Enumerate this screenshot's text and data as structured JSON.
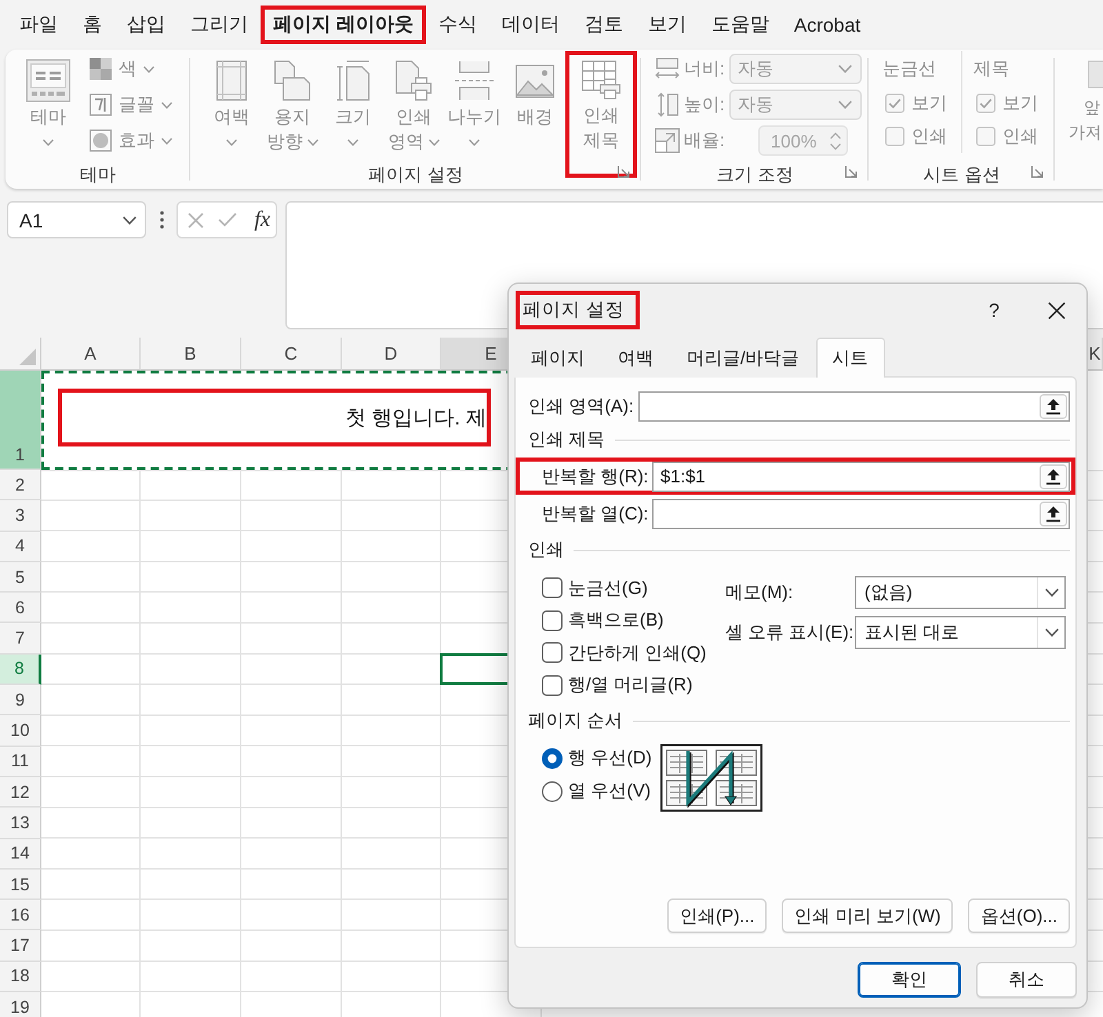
{
  "menu_tabs": [
    {
      "label": "파일",
      "selected": false,
      "highlighted": false
    },
    {
      "label": "홈",
      "selected": false,
      "highlighted": false
    },
    {
      "label": "삽입",
      "selected": false,
      "highlighted": false
    },
    {
      "label": "그리기",
      "selected": false,
      "highlighted": false
    },
    {
      "label": "페이지 레이아웃",
      "selected": true,
      "highlighted": true
    },
    {
      "label": "수식",
      "selected": false,
      "highlighted": false
    },
    {
      "label": "데이터",
      "selected": false,
      "highlighted": false
    },
    {
      "label": "검토",
      "selected": false,
      "highlighted": false
    },
    {
      "label": "보기",
      "selected": false,
      "highlighted": false
    },
    {
      "label": "도움말",
      "selected": false,
      "highlighted": false
    },
    {
      "label": "Acrobat",
      "selected": false,
      "highlighted": false
    }
  ],
  "ribbon": {
    "theme_group": {
      "title": "테마",
      "main": {
        "label": "테마",
        "dropdown": true
      },
      "items": [
        {
          "label": "색",
          "dropdown": true
        },
        {
          "label": "글꼴",
          "dropdown": true
        },
        {
          "label": "효과",
          "dropdown": true
        }
      ]
    },
    "page_setup_group": {
      "title": "페이지 설정",
      "buttons": [
        {
          "lines": [
            "여백"
          ],
          "dropdown": true,
          "highlighted": false
        },
        {
          "lines": [
            "용지",
            "방향"
          ],
          "dropdown": true,
          "highlighted": false
        },
        {
          "lines": [
            "크기"
          ],
          "dropdown": true,
          "highlighted": false
        },
        {
          "lines": [
            "인쇄",
            "영역"
          ],
          "dropdown": true,
          "highlighted": false
        },
        {
          "lines": [
            "나누기"
          ],
          "dropdown": true,
          "highlighted": false
        },
        {
          "lines": [
            "배경"
          ],
          "dropdown": false,
          "highlighted": false
        },
        {
          "lines": [
            "인쇄",
            "제목"
          ],
          "dropdown": false,
          "highlighted": true
        }
      ]
    },
    "scale_group": {
      "title": "크기 조정",
      "rows": [
        {
          "kind": "dropdown",
          "label": "너비:",
          "value": "자동"
        },
        {
          "kind": "dropdown",
          "label": "높이:",
          "value": "자동"
        },
        {
          "kind": "spinner",
          "label": "배율:",
          "value": "100%"
        }
      ]
    },
    "sheet_options_group": {
      "title": "시트 옵션",
      "columns": [
        {
          "heading": "눈금선",
          "options": [
            {
              "label": "보기",
              "checked": true
            },
            {
              "label": "인쇄",
              "checked": false
            }
          ]
        },
        {
          "heading": "제목",
          "options": [
            {
              "label": "보기",
              "checked": true
            },
            {
              "label": "인쇄",
              "checked": false
            }
          ]
        }
      ]
    },
    "group_5": {
      "lines": [
        "앞",
        "가져"
      ]
    }
  },
  "formula_bar": {
    "name_box": "A1",
    "function_label": "fx"
  },
  "sheet": {
    "columns": [
      {
        "label": "A",
        "active": false
      },
      {
        "label": "B",
        "active": false
      },
      {
        "label": "C",
        "active": false
      },
      {
        "label": "D",
        "active": false
      },
      {
        "label": "E",
        "active": true
      }
    ],
    "right_columns": [
      {
        "label": "K",
        "active": false
      }
    ],
    "title_row": {
      "label": "1",
      "selected": true,
      "marquee": true,
      "highlighted": true,
      "text": "첫 행입니다. 제"
    },
    "rows": [
      {
        "label": "2",
        "active": false
      },
      {
        "label": "3",
        "active": false
      },
      {
        "label": "4",
        "active": false
      },
      {
        "label": "5",
        "active": false
      },
      {
        "label": "6",
        "active": false
      },
      {
        "label": "7",
        "active": false
      },
      {
        "label": "8",
        "active": true
      },
      {
        "label": "9",
        "active": false
      },
      {
        "label": "10",
        "active": false
      },
      {
        "label": "11",
        "active": false
      },
      {
        "label": "12",
        "active": false
      },
      {
        "label": "13",
        "active": false
      },
      {
        "label": "14",
        "active": false
      },
      {
        "label": "15",
        "active": false
      },
      {
        "label": "16",
        "active": false
      },
      {
        "label": "17",
        "active": false
      },
      {
        "label": "18",
        "active": false
      },
      {
        "label": "19",
        "active": false
      }
    ]
  },
  "dialog": {
    "title": {
      "text": "페이지 설정",
      "highlighted": true
    },
    "help": "?",
    "tabs": [
      {
        "label": "페이지",
        "selected": false
      },
      {
        "label": "여백",
        "selected": false
      },
      {
        "label": "머리글/바닥글",
        "selected": false
      },
      {
        "label": "시트",
        "selected": true
      }
    ],
    "print_area": {
      "label": "인쇄 영역(A):"
    },
    "print_titles": {
      "heading": "인쇄 제목",
      "fields": [
        {
          "label": "반복할 행(R):",
          "value": "$1:$1",
          "highlighted": true
        },
        {
          "label": "반복할 열(C):",
          "highlighted": false
        }
      ]
    },
    "print": {
      "heading": "인쇄",
      "options": [
        {
          "label": "눈금선(G)",
          "checked": false
        },
        {
          "label": "흑백으로(B)",
          "checked": false
        },
        {
          "label": "간단하게 인쇄(Q)",
          "checked": false
        },
        {
          "label": "행/열 머리글(R)",
          "checked": false
        }
      ],
      "selects": [
        {
          "label": "메모(M):",
          "value": "(없음)"
        },
        {
          "label": "셀 오류 표시(E):",
          "value": "표시된 대로"
        }
      ]
    },
    "page_order": {
      "heading": "페이지 순서",
      "options": [
        {
          "label": "행 우선(D)",
          "selected": true
        },
        {
          "label": "열 우선(V)",
          "selected": false
        }
      ]
    },
    "actions": [
      "인쇄(P)...",
      "인쇄 미리 보기(W)",
      "옵션(O)..."
    ],
    "buttons": [
      {
        "label": "확인",
        "default": true
      },
      {
        "label": "취소",
        "default": false
      }
    ]
  }
}
